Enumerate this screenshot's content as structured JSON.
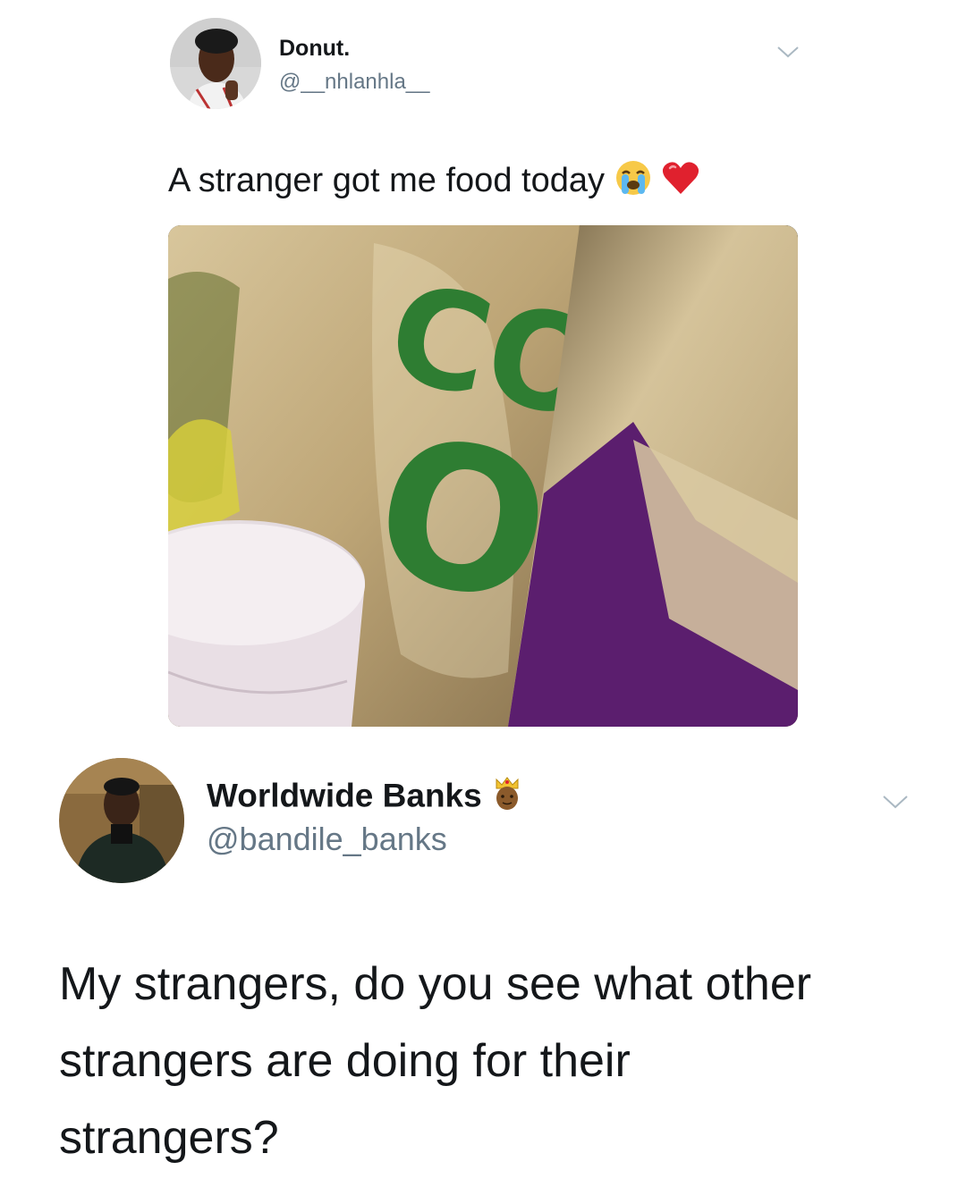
{
  "tweet1": {
    "display_name": "Donut.",
    "handle": "@__nhlanhla__",
    "text": "A stranger got me food today",
    "emojis": [
      "loudly-crying-face-icon",
      "red-heart-icon"
    ],
    "avatar": "avatar-photo"
  },
  "tweet2": {
    "display_name": "Worldwide Banks",
    "name_emoji": "crowned-man-icon",
    "handle": "@bandile_banks",
    "text_lines": [
      "My strangers, do you see what other",
      "strangers are doing for their",
      "strangers?"
    ],
    "avatar": "avatar-photo"
  },
  "colors": {
    "text": "#14171a",
    "secondary": "#657786",
    "chevron": "#aab8c2",
    "bag_green": "#2e7d32",
    "bag_purple": "#5b1e6e",
    "paper": "#c9b48a"
  }
}
